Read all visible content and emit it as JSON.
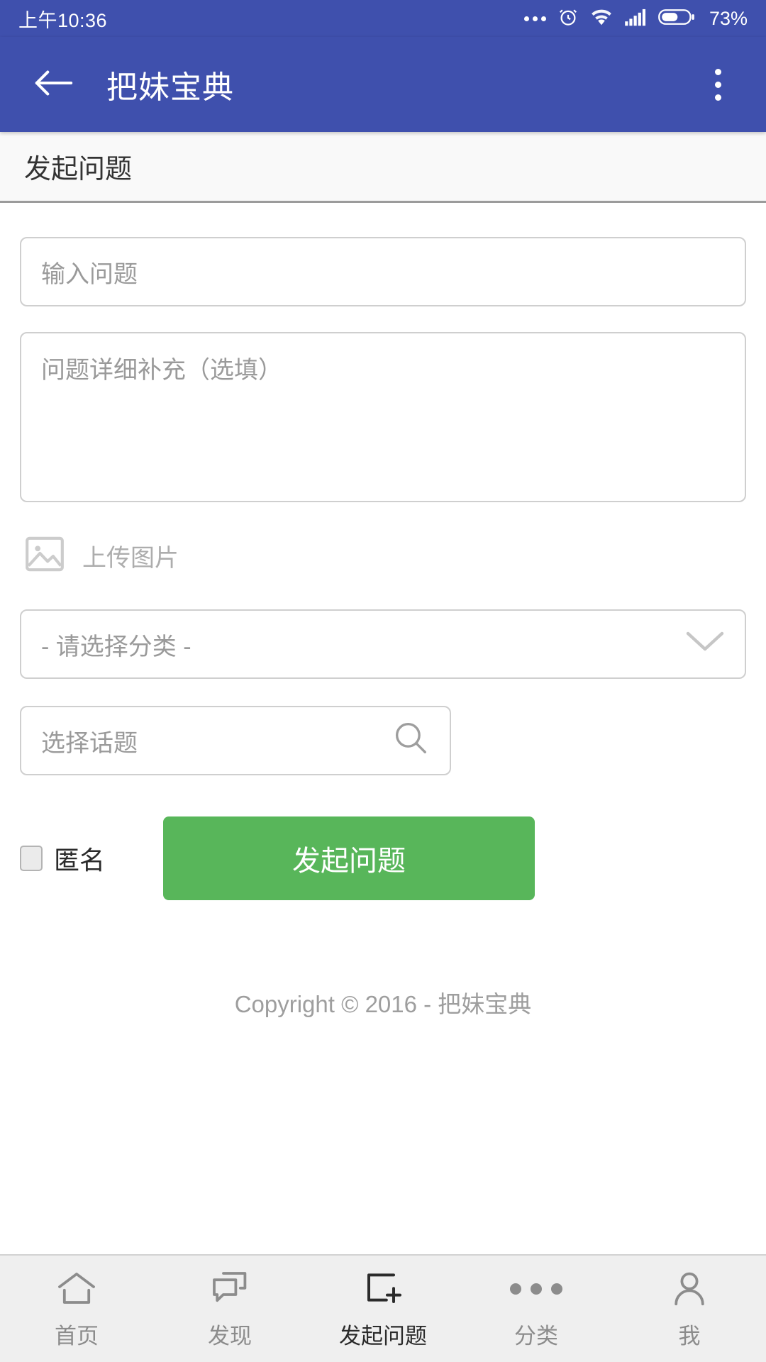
{
  "status_bar": {
    "time": "上午10:36",
    "battery_percent": "73%",
    "icons": [
      "more-dots-icon",
      "alarm-clock-icon",
      "wifi-icon",
      "signal-icon",
      "battery-icon"
    ]
  },
  "app_bar": {
    "back_icon": "back-arrow-icon",
    "title": "把妹宝典",
    "overflow_icon": "overflow-menu-icon"
  },
  "page_head": {
    "title": "发起问题"
  },
  "form": {
    "question_title_placeholder": "输入问题",
    "question_title_value": "",
    "question_detail_placeholder": "问题详细补充（选填）",
    "question_detail_value": "",
    "upload_label": "上传图片",
    "upload_icon": "image-icon",
    "category_placeholder": "- 请选择分类 -",
    "category_value": "",
    "category_icon": "chevron-down-icon",
    "topic_placeholder": "选择话题",
    "topic_value": "",
    "topic_icon": "search-icon",
    "anonymous_label": "匿名",
    "anonymous_checked": false,
    "submit_label": "发起问题",
    "submit_color": "#58b65a"
  },
  "footer": {
    "copyright": "Copyright © 2016 - 把妹宝典"
  },
  "bottom_nav": {
    "items": [
      {
        "label": "首页",
        "icon": "home-icon",
        "active": false
      },
      {
        "label": "发现",
        "icon": "chat-bubbles-icon",
        "active": false
      },
      {
        "label": "发起问题",
        "icon": "add-square-icon",
        "active": true
      },
      {
        "label": "分类",
        "icon": "more-dots-icon",
        "active": false
      },
      {
        "label": "我",
        "icon": "person-icon",
        "active": false
      }
    ]
  },
  "colors": {
    "primary": "#3f50ad",
    "accent_green": "#58b65a",
    "text_muted": "#9a9a9a"
  }
}
